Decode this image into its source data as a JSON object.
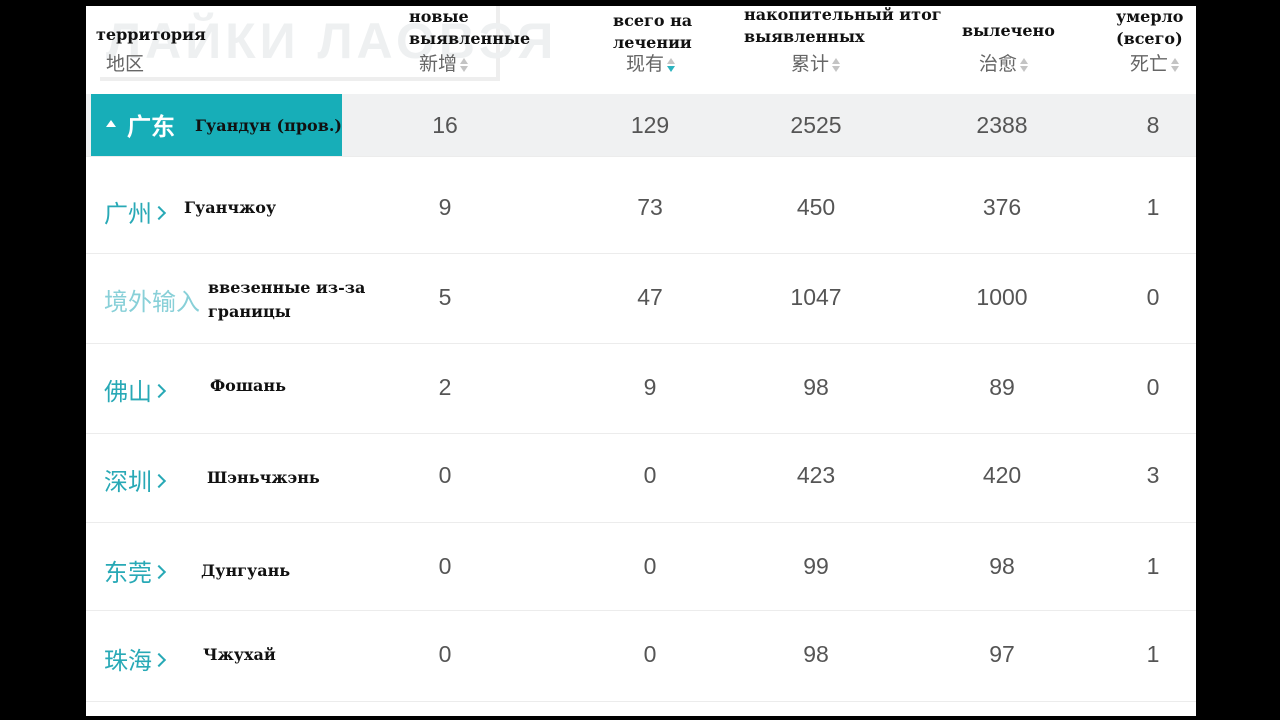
{
  "watermark": "ЛАЙКИ ЛАОВЭЯ",
  "columns": [
    {
      "ru": "территория",
      "cn": "地区"
    },
    {
      "ru": "новые выявленные",
      "cn": "新增"
    },
    {
      "ru": "всего на лечении",
      "cn": "现有"
    },
    {
      "ru": "накопительный итог выявленных",
      "cn": "累计"
    },
    {
      "ru": "вылечено",
      "cn": "治愈"
    },
    {
      "ru": "умерло (всего)",
      "cn": "死亡"
    }
  ],
  "province": {
    "cn": "广东",
    "ru": "Гуандун (пров.)",
    "new": "16",
    "current": "129",
    "total": "2525",
    "cured": "2388",
    "dead": "8"
  },
  "rows": [
    {
      "cn": "广州",
      "ru": "Гуанчжоу",
      "new": "9",
      "current": "73",
      "total": "450",
      "cured": "376",
      "dead": "1"
    },
    {
      "cn": "境外输入",
      "ru": "ввезенные из-за границы",
      "new": "5",
      "current": "47",
      "total": "1047",
      "cured": "1000",
      "dead": "0"
    },
    {
      "cn": "佛山",
      "ru": "Фошань",
      "new": "2",
      "current": "9",
      "total": "98",
      "cured": "89",
      "dead": "0"
    },
    {
      "cn": "深圳",
      "ru": "Шэньчжэнь",
      "new": "0",
      "current": "0",
      "total": "423",
      "cured": "420",
      "dead": "3"
    },
    {
      "cn": "东莞",
      "ru": "Дунгуань",
      "new": "0",
      "current": "0",
      "total": "99",
      "cured": "98",
      "dead": "1"
    },
    {
      "cn": "珠海",
      "ru": "Чжухай",
      "new": "0",
      "current": "0",
      "total": "98",
      "cured": "97",
      "dead": "1"
    }
  ],
  "colors": {
    "accent": "#17aeb8",
    "city_link": "#28a9b6",
    "import_link": "#88d0d8"
  }
}
